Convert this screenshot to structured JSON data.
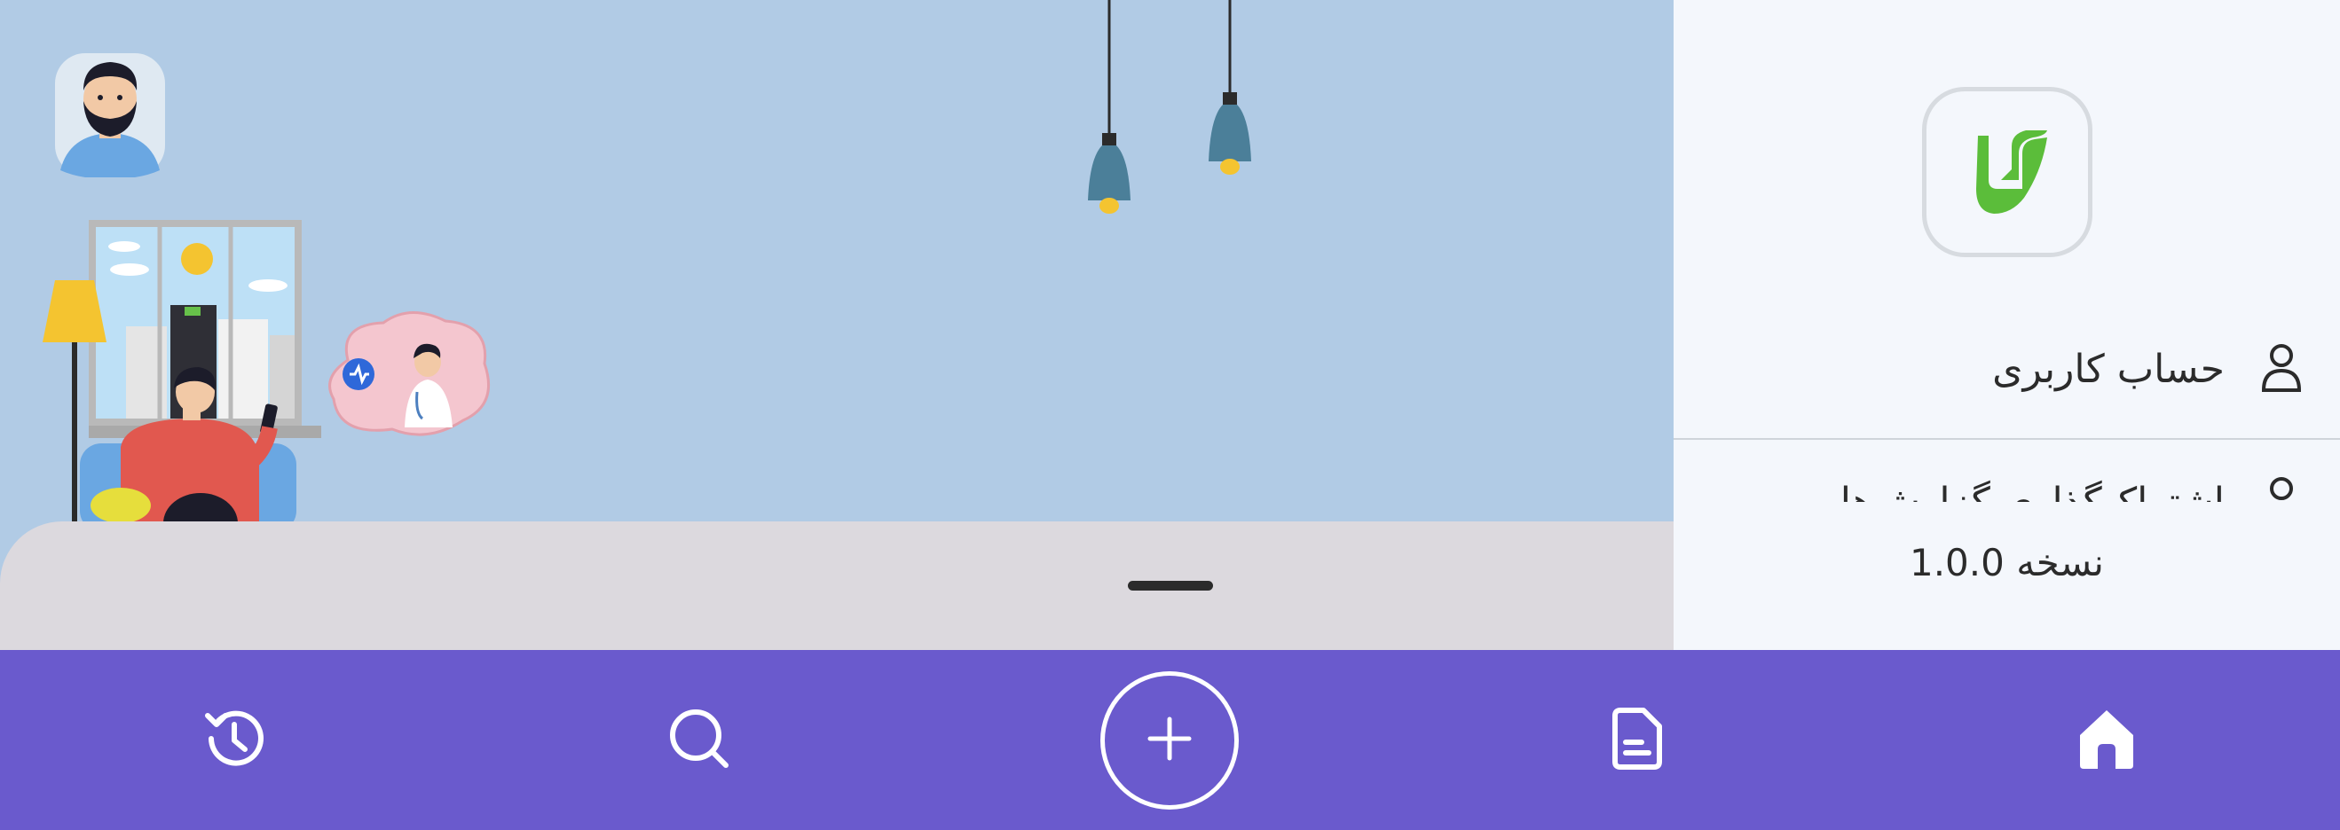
{
  "drawer": {
    "menu": [
      {
        "label": "حساب کاربری",
        "icon": "user-icon"
      },
      {
        "label": "اشتراک‌گذاری گزارش‌ها",
        "icon": "share-icon"
      }
    ],
    "version_text": "نسخه 1.0.0"
  },
  "bottom_nav": {
    "items": [
      {
        "name": "history",
        "icon": "history-icon"
      },
      {
        "name": "search",
        "icon": "search-icon"
      },
      {
        "name": "add",
        "icon": "plus-icon"
      },
      {
        "name": "reports",
        "icon": "document-icon"
      },
      {
        "name": "home",
        "icon": "home-icon",
        "active": true
      }
    ]
  },
  "colors": {
    "nav_background": "#6a5acd",
    "hero_background": "#b1cbe5",
    "drawer_background": "#f4f7fc",
    "logo_green": "#5bbd3a"
  }
}
